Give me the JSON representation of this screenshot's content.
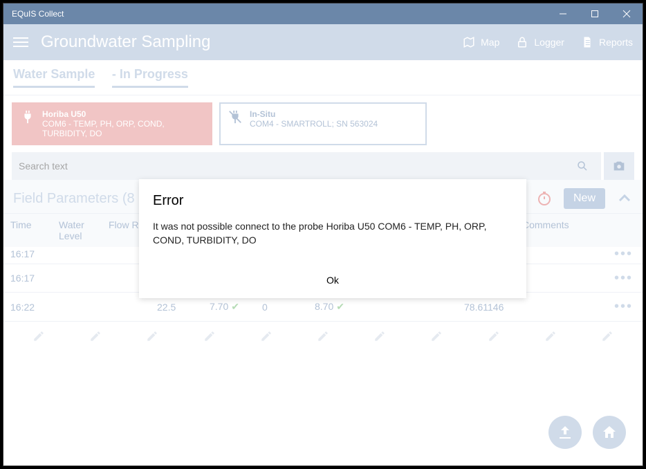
{
  "window": {
    "title": "EQuIS Collect"
  },
  "header": {
    "title": "Groundwater Sampling",
    "actions": {
      "map": "Map",
      "logger": "Logger",
      "reports": "Reports"
    }
  },
  "tabs": {
    "t1": "Water Sample",
    "t2": "- In Progress"
  },
  "devices": {
    "active": {
      "name": "Horiba U50",
      "desc": "COM6 - TEMP, PH, ORP, COND, TURBIDITY, DO"
    },
    "other": {
      "name": "In-Situ",
      "desc": "COM4 - SMARTROLL; SN 563024"
    }
  },
  "search": {
    "placeholder": "Search text"
  },
  "section": {
    "title": "Field Parameters (8",
    "new_label": "New"
  },
  "columns": {
    "time": "Time",
    "water_level": "Water Level",
    "flow_rate": "Flow Rate",
    "comments": "Comments"
  },
  "rows": [
    {
      "time": "16:17",
      "wl": "",
      "fr": "",
      "temp": "",
      "ph": "",
      "orp": "",
      "do": "",
      "turb": "",
      "cond": "",
      "last": ""
    },
    {
      "time": "16:17",
      "wl": "",
      "fr": "",
      "temp": "",
      "ph": "",
      "orp": "",
      "do": "",
      "turb": "",
      "cond": "",
      "last": ""
    },
    {
      "time": "16:22",
      "wl": "",
      "fr": "",
      "temp": "22.5",
      "ph": "7.70",
      "orp": "0",
      "do": "8.70",
      "turb": "",
      "cond": "",
      "last": "78.61146"
    }
  ],
  "modal": {
    "title": "Error",
    "message": "It was not possible connect to the probe Horiba U50 COM6 - TEMP, PH, ORP, COND, TURBIDITY, DO",
    "ok": "Ok"
  }
}
